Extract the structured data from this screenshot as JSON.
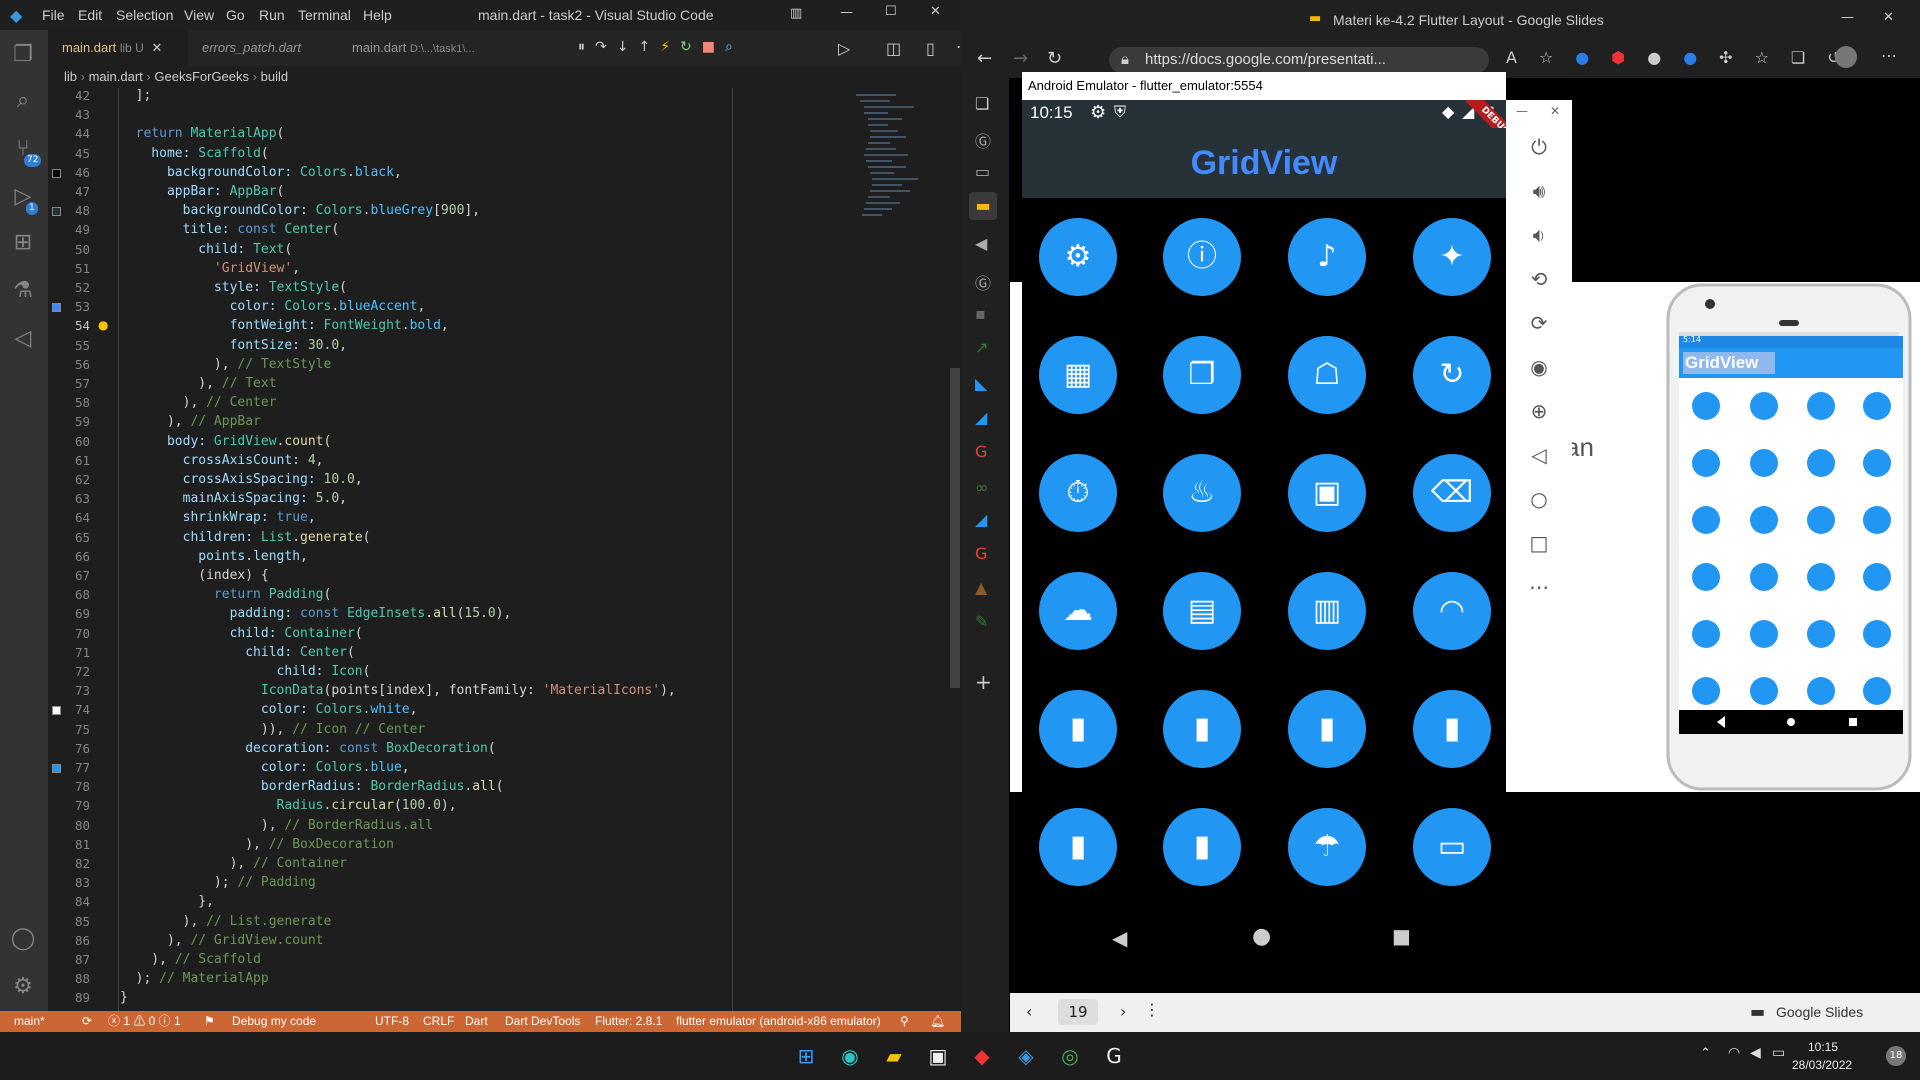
{
  "vscode": {
    "menu": [
      "File",
      "Edit",
      "Selection",
      "View",
      "Go",
      "Run",
      "Terminal",
      "Help"
    ],
    "window_title": "main.dart - task2 - Visual Studio Code",
    "tabs": [
      {
        "label": "main.dart",
        "sub": "lib U"
      },
      {
        "label": "errors_patch.dart"
      },
      {
        "label": "main.dart",
        "sub": "D:\\...\\task1\\..."
      }
    ],
    "breadcrumb": [
      "lib",
      "main.dart",
      "GeeksForGeeks",
      "build"
    ],
    "activity_badges": {
      "source_control": "72",
      "run": "1"
    },
    "line_start": 42,
    "current_line": 54,
    "code": [
      [
        [
          "  ];",
          "d"
        ]
      ],
      [
        [
          "",
          ""
        ]
      ],
      [
        [
          "  return ",
          "k"
        ],
        [
          "MaterialApp",
          "c"
        ],
        [
          "(",
          "d"
        ]
      ],
      [
        [
          "    home: ",
          "p"
        ],
        [
          "Scaffold",
          "c"
        ],
        [
          "(",
          "d"
        ]
      ],
      [
        [
          "      backgroundColor: ",
          "p"
        ],
        [
          "Colors",
          "c"
        ],
        [
          ".",
          "d"
        ],
        [
          "black",
          "cc"
        ],
        [
          ",",
          "d"
        ]
      ],
      [
        [
          "      appBar: ",
          "p"
        ],
        [
          "AppBar",
          "c"
        ],
        [
          "(",
          "d"
        ]
      ],
      [
        [
          "        backgroundColor: ",
          "p"
        ],
        [
          "Colors",
          "c"
        ],
        [
          ".",
          "d"
        ],
        [
          "blueGrey",
          "cc"
        ],
        [
          "[",
          "d"
        ],
        [
          "900",
          "n"
        ],
        [
          "],",
          "d"
        ]
      ],
      [
        [
          "        title: ",
          "p"
        ],
        [
          "const ",
          "k"
        ],
        [
          "Center",
          "c"
        ],
        [
          "(",
          "d"
        ]
      ],
      [
        [
          "          child: ",
          "p"
        ],
        [
          "Text",
          "c"
        ],
        [
          "(",
          "d"
        ]
      ],
      [
        [
          "            'GridView'",
          "s"
        ],
        [
          ",",
          "d"
        ]
      ],
      [
        [
          "            style: ",
          "p"
        ],
        [
          "TextStyle",
          "c"
        ],
        [
          "(",
          "d"
        ]
      ],
      [
        [
          "              color: ",
          "p"
        ],
        [
          "Colors",
          "c"
        ],
        [
          ".",
          "d"
        ],
        [
          "blueAccent",
          "cc"
        ],
        [
          ",",
          "d"
        ]
      ],
      [
        [
          "              fontWeight: ",
          "p"
        ],
        [
          "FontWeight",
          "c"
        ],
        [
          ".",
          "d"
        ],
        [
          "bold",
          "cc"
        ],
        [
          ",",
          "d"
        ]
      ],
      [
        [
          "              fontSize: ",
          "p"
        ],
        [
          "30.0",
          "n"
        ],
        [
          ",",
          "d"
        ]
      ],
      [
        [
          "            ), ",
          "d"
        ],
        [
          "// TextStyle",
          "cm"
        ]
      ],
      [
        [
          "          ), ",
          "d"
        ],
        [
          "// Text",
          "cm"
        ]
      ],
      [
        [
          "        ), ",
          "d"
        ],
        [
          "// Center",
          "cm"
        ]
      ],
      [
        [
          "      ), ",
          "d"
        ],
        [
          "// AppBar",
          "cm"
        ]
      ],
      [
        [
          "      body: ",
          "p"
        ],
        [
          "GridView",
          "c"
        ],
        [
          ".",
          "d"
        ],
        [
          "count",
          "f"
        ],
        [
          "(",
          "d"
        ]
      ],
      [
        [
          "        crossAxisCount: ",
          "p"
        ],
        [
          "4",
          "n"
        ],
        [
          ",",
          "d"
        ]
      ],
      [
        [
          "        crossAxisSpacing: ",
          "p"
        ],
        [
          "10.0",
          "n"
        ],
        [
          ",",
          "d"
        ]
      ],
      [
        [
          "        mainAxisSpacing: ",
          "p"
        ],
        [
          "5.0",
          "n"
        ],
        [
          ",",
          "d"
        ]
      ],
      [
        [
          "        shrinkWrap: ",
          "p"
        ],
        [
          "true",
          "k"
        ],
        [
          ",",
          "d"
        ]
      ],
      [
        [
          "        children: ",
          "p"
        ],
        [
          "List",
          "c"
        ],
        [
          ".",
          "d"
        ],
        [
          "generate",
          "f"
        ],
        [
          "(",
          "d"
        ]
      ],
      [
        [
          "          points",
          "p"
        ],
        [
          ".",
          "d"
        ],
        [
          "length",
          "p"
        ],
        [
          ",",
          "d"
        ]
      ],
      [
        [
          "          (index) {",
          "d"
        ]
      ],
      [
        [
          "            return ",
          "k"
        ],
        [
          "Padding",
          "c"
        ],
        [
          "(",
          "d"
        ]
      ],
      [
        [
          "              padding: ",
          "p"
        ],
        [
          "const ",
          "k"
        ],
        [
          "EdgeInsets",
          "c"
        ],
        [
          ".",
          "d"
        ],
        [
          "all",
          "f"
        ],
        [
          "(",
          "d"
        ],
        [
          "15.0",
          "n"
        ],
        [
          "),",
          "d"
        ]
      ],
      [
        [
          "              child: ",
          "p"
        ],
        [
          "Container",
          "c"
        ],
        [
          "(",
          "d"
        ]
      ],
      [
        [
          "                child: ",
          "p"
        ],
        [
          "Center",
          "c"
        ],
        [
          "(",
          "d"
        ]
      ],
      [
        [
          "                    child: ",
          "p"
        ],
        [
          "Icon",
          "c"
        ],
        [
          "(",
          "d"
        ]
      ],
      [
        [
          "                  IconData",
          "c"
        ],
        [
          "(points[index], fontFamily: ",
          "d"
        ],
        [
          "'MaterialIcons'",
          "s"
        ],
        [
          "),",
          "d"
        ]
      ],
      [
        [
          "                  color: ",
          "p"
        ],
        [
          "Colors",
          "c"
        ],
        [
          ".",
          "d"
        ],
        [
          "white",
          "cc"
        ],
        [
          ",",
          "d"
        ]
      ],
      [
        [
          "                  )), ",
          "d"
        ],
        [
          "// Icon // Center",
          "cm"
        ]
      ],
      [
        [
          "                decoration: ",
          "p"
        ],
        [
          "const ",
          "k"
        ],
        [
          "BoxDecoration",
          "c"
        ],
        [
          "(",
          "d"
        ]
      ],
      [
        [
          "                  color: ",
          "p"
        ],
        [
          "Colors",
          "c"
        ],
        [
          ".",
          "d"
        ],
        [
          "blue",
          "cc"
        ],
        [
          ",",
          "d"
        ]
      ],
      [
        [
          "                  borderRadius: ",
          "p"
        ],
        [
          "BorderRadius",
          "c"
        ],
        [
          ".",
          "d"
        ],
        [
          "all",
          "f"
        ],
        [
          "(",
          "d"
        ]
      ],
      [
        [
          "                    Radius",
          "c"
        ],
        [
          ".",
          "d"
        ],
        [
          "circular",
          "f"
        ],
        [
          "(",
          "d"
        ],
        [
          "100.0",
          "n"
        ],
        [
          "),",
          "d"
        ]
      ],
      [
        [
          "                  ), ",
          "d"
        ],
        [
          "// BorderRadius.all",
          "cm"
        ]
      ],
      [
        [
          "                ), ",
          "d"
        ],
        [
          "// BoxDecoration",
          "cm"
        ]
      ],
      [
        [
          "              ), ",
          "d"
        ],
        [
          "// Container",
          "cm"
        ]
      ],
      [
        [
          "            ); ",
          "d"
        ],
        [
          "// Padding",
          "cm"
        ]
      ],
      [
        [
          "          },",
          "d"
        ]
      ],
      [
        [
          "        ), ",
          "d"
        ],
        [
          "// List.generate",
          "cm"
        ]
      ],
      [
        [
          "      ), ",
          "d"
        ],
        [
          "// GridView.count",
          "cm"
        ]
      ],
      [
        [
          "    ), ",
          "d"
        ],
        [
          "// Scaffold",
          "cm"
        ]
      ],
      [
        [
          "  ); ",
          "d"
        ],
        [
          "// MaterialApp",
          "cm"
        ]
      ],
      [
        [
          "}",
          "d"
        ]
      ],
      [
        [
          "}",
          "d"
        ]
      ]
    ],
    "status": {
      "branch": "main*",
      "problems": "ⓧ 1 ⚠ 0 ⓘ 1",
      "debug": "Debug my code",
      "encoding": "UTF-8",
      "eol": "CRLF",
      "language": "Dart",
      "devtools": "Dart DevTools",
      "flutter": "Flutter: 2.8.1",
      "device": "flutter emulator (android-x86 emulator)"
    }
  },
  "browser": {
    "window_title": "Materi ke-4.2 Flutter Layout - Google Slides",
    "url": "https://docs.google.com/presentati...",
    "page_number": "19",
    "slides_label": "Google Slides",
    "slide_text": "an"
  },
  "emulator": {
    "title": "Android Emulator - flutter_emulator:5554",
    "time": "10:15",
    "debug_banner": "DEBUG",
    "appbar_title": "GridView",
    "grid_icons": [
      "⚙",
      "ⓘ",
      "♪",
      "✦",
      "▦",
      "❐",
      "☖",
      "↻",
      "⏱",
      "♨",
      "▣",
      "⌫",
      "☁",
      "▤",
      "▥",
      "◠",
      "▮",
      "▮",
      "▮",
      "▮",
      "▮",
      "▮",
      "☂",
      "▭"
    ]
  },
  "small_phone": {
    "appbar_title": "GridView",
    "time": "5:14"
  },
  "taskbar": {
    "time": "10:15",
    "date": "28/03/2022",
    "notif": "18"
  },
  "colors": {
    "vscode_bg": "#1e1e1e",
    "statusbar": "#cc6633",
    "appbar": "#263238",
    "grid_blue": "#2196f3",
    "title_blue": "#448aff"
  }
}
